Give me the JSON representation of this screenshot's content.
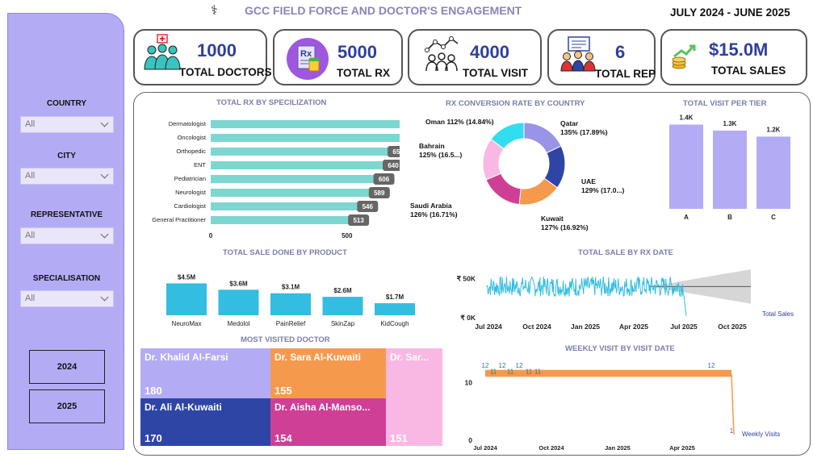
{
  "header": {
    "title": "GCC FIELD FORCE AND DOCTOR'S ENGAGEMENT",
    "period": "JULY 2024 -  JUNE 2025"
  },
  "filters": {
    "country": {
      "label": "COUNTRY",
      "value": "All"
    },
    "city": {
      "label": "CITY",
      "value": "All"
    },
    "representative": {
      "label": "REPRESENTATIVE",
      "value": "All"
    },
    "specialisation": {
      "label": "SPECIALISATION",
      "value": "All"
    },
    "year_buttons": [
      "2024",
      "2025"
    ]
  },
  "kpis": [
    {
      "value": "1000",
      "label": "TOTAL DOCTORS",
      "icon": "doctors-icon"
    },
    {
      "value": "5000",
      "label": "TOTAL RX",
      "icon": "prescription-icon"
    },
    {
      "value": "4000",
      "label": "TOTAL VISIT",
      "icon": "people-network-icon"
    },
    {
      "value": "6",
      "label": "TOTAL REP",
      "icon": "reps-icon"
    },
    {
      "value": "$15.0M",
      "label": "TOTAL SALES",
      "icon": "sales-growth-icon"
    }
  ],
  "colors": {
    "accent": "#b3acf5",
    "teal": "#7dd6d0",
    "cyan": "#33bde0",
    "kpi_value": "#2e3f9e",
    "panel_title": "#7a7ea8",
    "orange": "#f59a4c"
  },
  "chart_data": [
    {
      "id": "rx-by-specialization",
      "type": "bar",
      "orientation": "horizontal",
      "title": "TOTAL RX BY SPECILIZATION",
      "categories": [
        "Dermatologist",
        "Oncologist",
        "Orthopedic",
        "ENT",
        "Pediatrician",
        "Neurologist",
        "Cardiologist",
        "General Practitioner"
      ],
      "values": [
        743,
        705,
        658,
        640,
        606,
        589,
        546,
        513
      ],
      "xticks": [
        "0",
        "500"
      ],
      "xlim": [
        0,
        800
      ]
    },
    {
      "id": "rx-conversion-by-country",
      "type": "pie",
      "donut": true,
      "title": "RX CONVERSION RATE BY COUNTRY",
      "slices": [
        {
          "name": "Qatar",
          "label": "135% (17.89%)",
          "share": 17.89,
          "color": "#9a94e6"
        },
        {
          "name": "UAE",
          "label": "129% (17.0...)",
          "share": 17.0,
          "color": "#2e45a6"
        },
        {
          "name": "Kuwait",
          "label": "127% (16.92%)",
          "share": 16.92,
          "color": "#f59a4c"
        },
        {
          "name": "Saudi Arabia",
          "label": "126% (16.71%)",
          "share": 16.71,
          "color": "#cf3f95"
        },
        {
          "name": "Bahrain",
          "label": "125% (16.5...)",
          "share": 16.5,
          "color": "#f9b8e3"
        },
        {
          "name": "Oman",
          "label": "112% (14.84%)",
          "share": 14.84,
          "color": "#33ddf0"
        }
      ]
    },
    {
      "id": "visit-per-tier",
      "type": "bar",
      "title": "TOTAL VISIT PER TIER",
      "categories": [
        "A",
        "B",
        "C"
      ],
      "values": [
        1400,
        1300,
        1200
      ],
      "value_labels": [
        "1.4K",
        "1.3K",
        "1.2K"
      ],
      "ylim": [
        0,
        1500
      ]
    },
    {
      "id": "sale-by-product",
      "type": "bar",
      "title": "TOTAL SALE DONE BY PRODUCT",
      "categories": [
        "NeuroMax",
        "Medolol",
        "PainRelief",
        "SkinZap",
        "KidCough"
      ],
      "values": [
        4.5,
        3.6,
        3.1,
        2.6,
        1.7
      ],
      "value_labels": [
        "$4.5M",
        "$3.6M",
        "$3.1M",
        "$2.6M",
        "$1.7M"
      ],
      "ylim": [
        0,
        5
      ]
    },
    {
      "id": "sale-by-rx-date",
      "type": "line",
      "title": "TOTAL SALE BY RX DATE",
      "series_name": "Total Sales",
      "yticks": [
        "₹ 0K",
        "₹ 50K"
      ],
      "xticks": [
        "Jul 2024",
        "Oct 2024",
        "Jan 2025",
        "Apr 2025",
        "Jul 2025",
        "Oct 2025"
      ],
      "ylim": [
        0,
        60000
      ],
      "approx_daily_level": 40000,
      "last_point_value": 2000,
      "forecast": true
    },
    {
      "id": "weekly-visit",
      "type": "line",
      "title": "WEEKLY VISIT BY VISIT DATE",
      "series_name": "Weekly Visits",
      "yticks": [
        "0",
        "10"
      ],
      "xticks": [
        "Jul 2024",
        "Oct 2024",
        "Jan 2025",
        "Apr 2025"
      ],
      "ylim": [
        0,
        13
      ],
      "point_labels": [
        "12",
        "11",
        "12",
        "11",
        "12",
        "11",
        "11",
        "12",
        "1"
      ],
      "approx_weekly_level": 11.5,
      "last_point_value": 1
    }
  ],
  "most_visited": {
    "title": "MOST VISITED DOCTOR",
    "items": [
      {
        "name": "Dr. Khalid Al-Farsi",
        "value": "180",
        "color": "#b3acf5"
      },
      {
        "name": "Dr. Sara Al-Kuwaiti",
        "value": "155",
        "color": "#f59a4c"
      },
      {
        "name": "Dr. Sar...",
        "value": "151",
        "color": "#f9b8e3"
      },
      {
        "name": "Dr. Ali Al-Kuwaiti",
        "value": "170",
        "color": "#2e45a6"
      },
      {
        "name": "Dr. Aisha Al-Manso...",
        "value": "154",
        "color": "#cf3f95"
      }
    ]
  }
}
